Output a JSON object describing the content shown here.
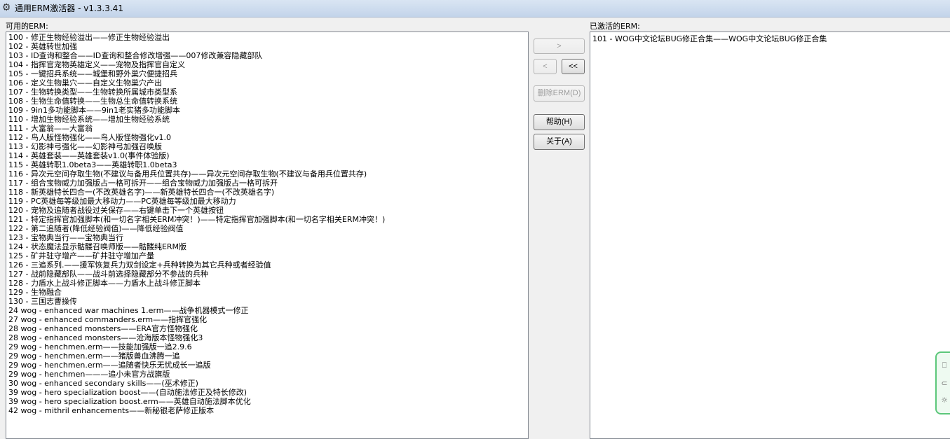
{
  "window": {
    "title": "通用ERM激活器 - v1.3.3.41",
    "icon": "gear-icon"
  },
  "available": {
    "label": "可用的ERM:",
    "items": [
      "100 - 修正生物经验溢出——修正生物经验溢出",
      "102 - 英雄转世加强",
      "103 - ID查询和整合——ID查询和整合修改增强——007修改兼容隐藏部队",
      "104 - 指挥官宠物英雄定义——宠物及指挥官自定义",
      "105 - 一键招兵系统——城堡和野外巢穴便捷招兵",
      "106 - 定义生物巢穴——自定义生物巢穴产出",
      "107 - 生物转换类型——生物转换所属城市类型系",
      "108 - 生物生命值转换——生物总生命值转换系统",
      "109 - 9in1多功能脚本——9in1老实猪多功能脚本",
      "110 - 增加生物经验系统——增加生物经验系统",
      "111 - 大富翁——大富翁",
      "112 - 鸟人版怪物强化——鸟人版怪物强化v1.0",
      "113 - 幻影神弓强化——幻影神弓加强召唤版",
      "114 - 英雄套装——英雄套装v1.0(事件体验版)",
      "115 - 英雄转职1.0beta3——英雄转职1.0beta3",
      "116 - 异次元空间存取生物(不建议与备用兵位置共存)——异次元空间存取生物(不建议与备用兵位置共存)",
      "117 - 组合宝物威力加强版占一格可拆开——组合宝物威力加强版占一格可拆开",
      "118 - 新英雄特长四合一(不改英雄名字)——新英雄特长四合一(不改英雄名字)",
      "119 - PC英雄每等级加最大移动力——PC英雄每等级加最大移动力",
      "120 - 宠物及追随者战役过关保存——右键单击下一个英雄按钮",
      "121 - 特定指挥官加强脚本(和一切名字相关ERM冲突！)——特定指挥官加强脚本(和一切名字相关ERM冲突！)",
      "122 - 第二追随者(降低经验阀值)——降低经验阀值",
      "123 - 宝物典当行——宝物典当行",
      "124 - 状态魔法显示骷髅召唤师版——骷髅纯ERM版",
      "125 - 矿井驻守增产——矿井驻守增加产量",
      "126 - 三追系列.——援军恢复兵力双剑设定+兵种转换为其它兵种或者经验值",
      "127 - 战前隐藏部队——战斗前选择隐藏部分不参战的兵种",
      "128 - 力盾水上战斗修正脚本——力盾水上战斗修正脚本",
      "129 - 生物融合",
      "130 - 三国志曹操传",
      "24 wog - enhanced war machines 1.erm——战争机器模式一修正",
      "27 wog - enhanced commanders.erm——指挥官强化",
      "28 wog - enhanced monsters——ERA官方怪物强化",
      "28 wog - enhanced monsters——沧海版本怪物强化3",
      "29 wog - henchmen.erm——技能加强版一追2.9.6",
      "29 wog - henchmen.erm——猪版兽血沸腾一追",
      "29 wog - henchmen.erm——追随者快乐无忧成长一追版",
      "29 wog - henchmen———追小未官方战旗版",
      "30 wog - enhanced secondary skills——(巫术修正)",
      "39 wog - hero specialization boost——(自动施法修正及特长修改)",
      "39 wog - hero specialization boost.erm——英雄自动施法脚本优化",
      "42 wog - mithril enhancements——新秘银老萨修正版本"
    ]
  },
  "activated": {
    "label": "已激活的ERM:",
    "items": [
      "101 - WOG中文论坛BUG修正合集——WOG中文论坛BUG修正合集"
    ]
  },
  "buttons": {
    "add": ">",
    "remove": "<",
    "remove_all": "<<",
    "delete": "删除ERM(D)",
    "help": "帮助(H)",
    "about": "关于(A)"
  },
  "side_widget": {
    "glyphs": [
      "⎕",
      "⊂",
      "☼"
    ]
  }
}
